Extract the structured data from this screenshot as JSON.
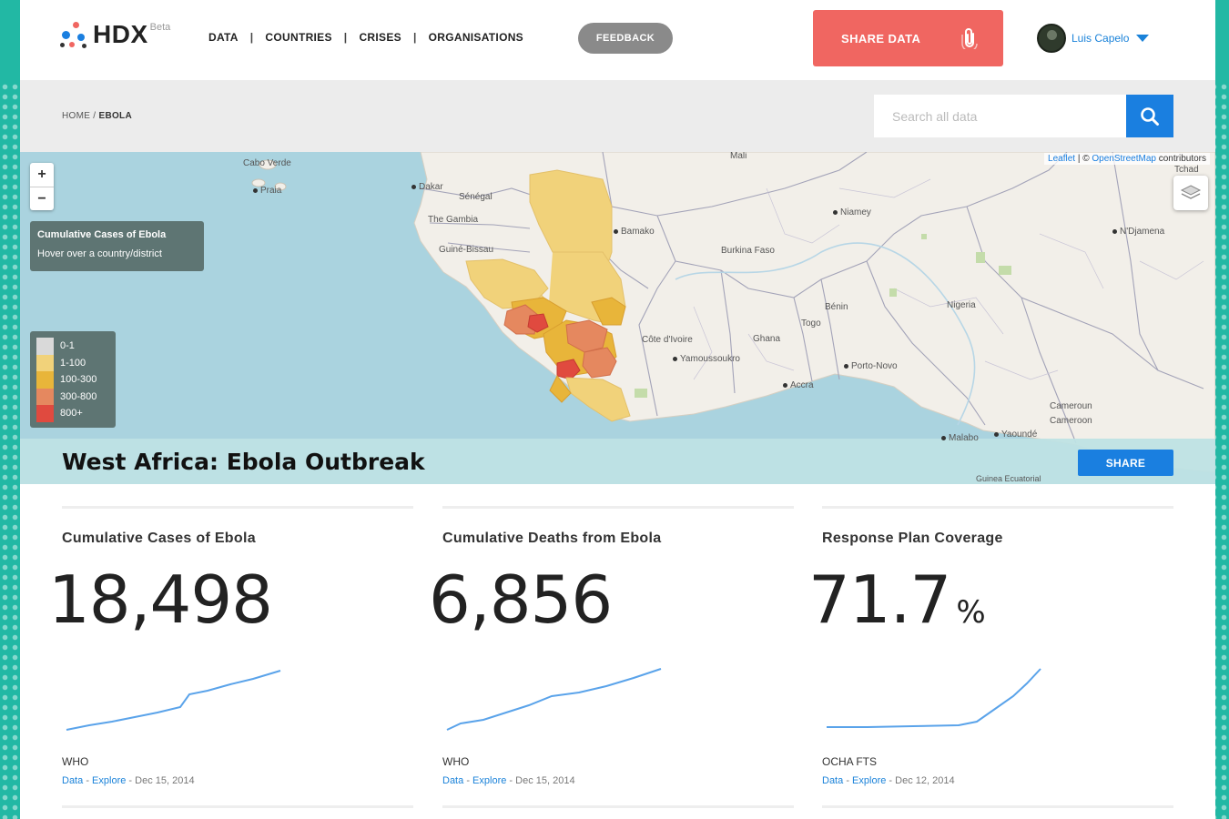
{
  "header": {
    "logo_text": "HDX",
    "logo_badge": "Beta",
    "nav": [
      {
        "label": "DATA"
      },
      {
        "label": "COUNTRIES"
      },
      {
        "label": "CRISES"
      },
      {
        "label": "ORGANISATIONS"
      }
    ],
    "nav_separator": "|",
    "feedback_label": "FEEDBACK",
    "share_data_label": "SHARE DATA",
    "user_name": "Luis Capelo"
  },
  "breadcrumb": {
    "home": "HOME",
    "separator": "/",
    "current": "EBOLA"
  },
  "search": {
    "placeholder": "Search all data"
  },
  "map": {
    "zoom_in": "+",
    "zoom_out": "−",
    "attribution_leaflet": "Leaflet",
    "attribution_sep": "| ©",
    "attribution_osm": "OpenStreetMap",
    "attribution_rest": "contributors",
    "info_title": "Cumulative Cases of Ebola",
    "info_hint": "Hover over a country/district",
    "legend": [
      {
        "label": "0-1",
        "color": "#d9d9d9"
      },
      {
        "label": "1-100",
        "color": "#f1d27a"
      },
      {
        "label": "100-300",
        "color": "#e8b53a"
      },
      {
        "label": "300-800",
        "color": "#e5885f"
      },
      {
        "label": "800+",
        "color": "#e04a3f"
      }
    ],
    "labels": {
      "cabo_verde": "Cabo Verde",
      "praia": "Praia",
      "mali": "Mali",
      "dakar": "Dakar",
      "senegal": "Sénégal",
      "the_gambia": "The Gambia",
      "guine_bissau": "Guiné-Bissau",
      "bamako": "Bamako",
      "burkina_faso": "Burkina Faso",
      "niamey": "Niamey",
      "ndjamena": "N'Djamena",
      "tchad": "Tchad",
      "nigeria": "Nigeria",
      "benin": "Bénin",
      "togo": "Togo",
      "ghana": "Ghana",
      "cote_divoire": "Côte d'Ivoire",
      "yamoussoukro": "Yamoussoukro",
      "porto_novo": "Porto-Novo",
      "accra": "Accra",
      "cameroun": "Cameroun",
      "cameroon": "Cameroon",
      "malabo": "Malabo",
      "yaounde": "Yaoundé",
      "guinea_ecuatorial": "Guinea Ecuatorial"
    }
  },
  "page_title": "West Africa: Ebola Outbreak",
  "share_label": "SHARE",
  "stats": [
    {
      "label": "Cumulative Cases of Ebola",
      "value": "18,498",
      "unit": "",
      "source": "WHO",
      "data_link": "Data",
      "explore_link": "Explore",
      "date": "Dec 15, 2014"
    },
    {
      "label": "Cumulative Deaths from Ebola",
      "value": "6,856",
      "unit": "",
      "source": "WHO",
      "data_link": "Data",
      "explore_link": "Explore",
      "date": "Dec 15, 2014"
    },
    {
      "label": "Response Plan Coverage",
      "value": "71.7",
      "unit": "%",
      "source": "OCHA FTS",
      "data_link": "Data",
      "explore_link": "Explore",
      "date": "Dec 12, 2014"
    }
  ],
  "meta_sep": "-",
  "colors": {
    "teal_frame": "#22b8a4",
    "share_data": "#f06661",
    "primary_blue": "#1a7fe0",
    "feedback_grey": "#8a8a8a",
    "sea": "#aad3df",
    "land": "#f2efe9",
    "sparkline": "#5aa3ea"
  }
}
